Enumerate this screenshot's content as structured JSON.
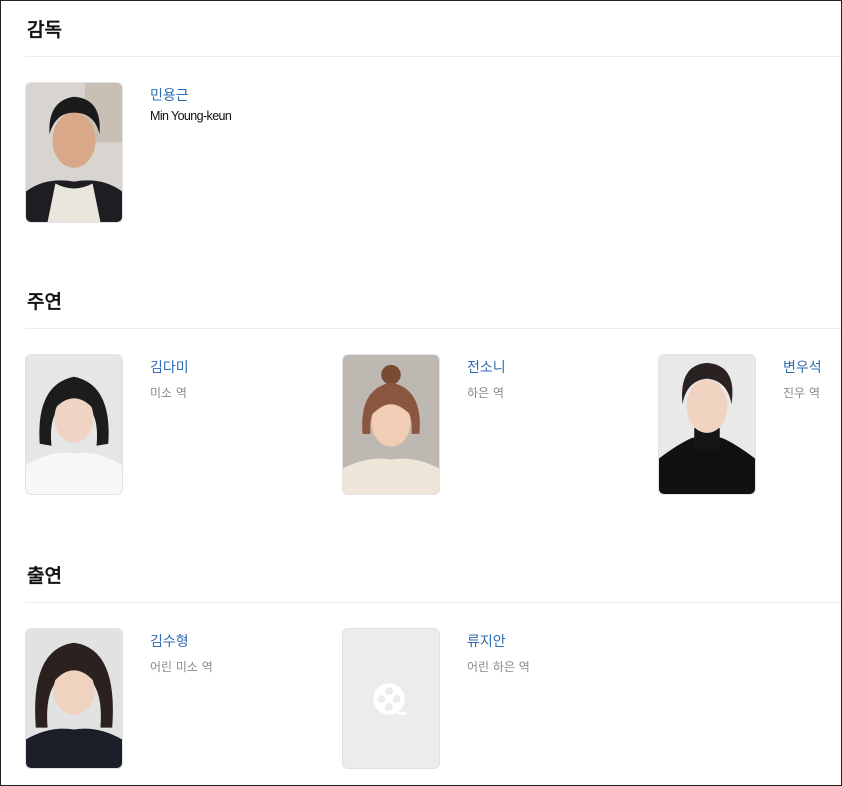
{
  "sections": [
    {
      "title": "감독",
      "people": [
        {
          "name": "민용근",
          "english_name": "Min Young-keun",
          "photo_icon": "person-photo-icon"
        }
      ]
    },
    {
      "title": "주연",
      "people": [
        {
          "name": "김다미",
          "role": "미소 역",
          "photo_icon": "person-photo-icon"
        },
        {
          "name": "전소니",
          "role": "하은 역",
          "photo_icon": "person-photo-icon"
        },
        {
          "name": "변우석",
          "role": "진우 역",
          "photo_icon": "person-photo-icon"
        }
      ]
    },
    {
      "title": "출연",
      "people": [
        {
          "name": "김수형",
          "role": "어린 미소 역",
          "photo_icon": "person-photo-icon"
        },
        {
          "name": "류지안",
          "role": "어린 하은 역",
          "photo_icon": "film-reel-placeholder-icon"
        }
      ]
    }
  ],
  "colors": {
    "name_link": "#2f6bb3",
    "role_text": "#8a8a8a",
    "divider": "#ececec",
    "placeholder_bg": "#ececee"
  }
}
